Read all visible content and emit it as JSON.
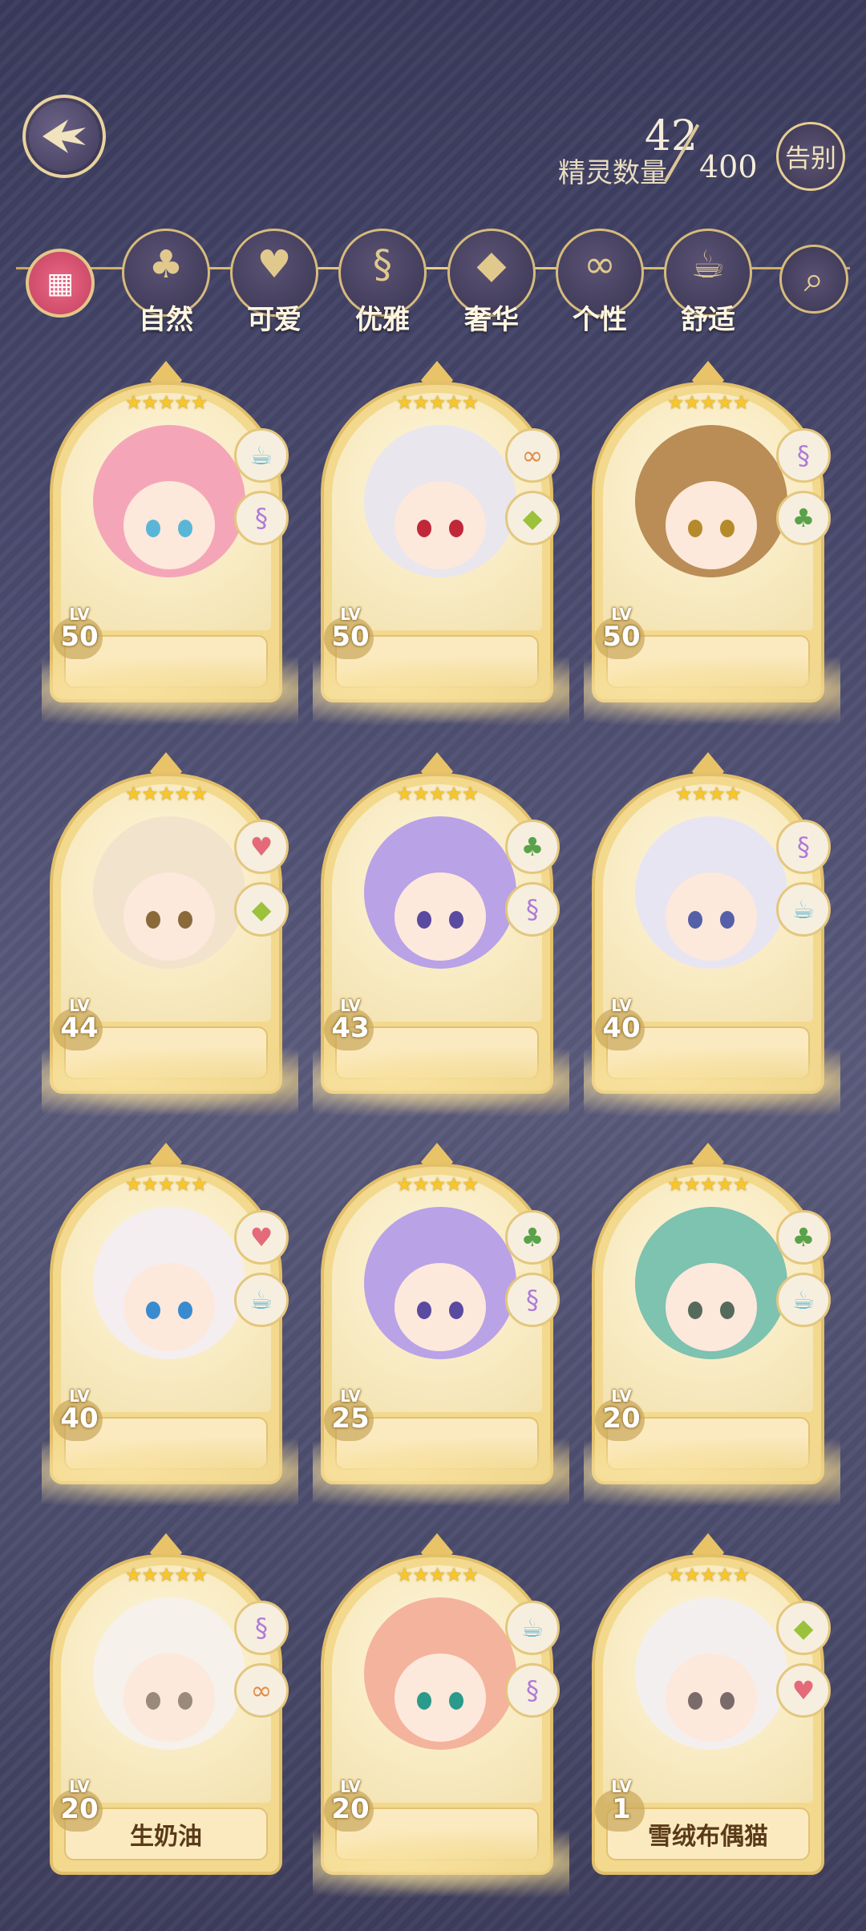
{
  "header": {
    "spirit_count": "42",
    "spirit_label": "精灵数量",
    "spirit_max": "400",
    "farewell_label": "告别"
  },
  "categories": [
    {
      "label": "自然",
      "icon": "clover-icon",
      "glyph": "♣"
    },
    {
      "label": "可爱",
      "icon": "heart-icon",
      "glyph": "♥"
    },
    {
      "label": "优雅",
      "icon": "swan-icon",
      "glyph": "§"
    },
    {
      "label": "奢华",
      "icon": "diamond-icon",
      "glyph": "◆"
    },
    {
      "label": "个性",
      "icon": "glasses-icon",
      "glyph": "∞"
    },
    {
      "label": "舒适",
      "icon": "teacup-icon",
      "glyph": "☕"
    }
  ],
  "cards": [
    {
      "level": "50",
      "lv": "LV",
      "stars": "★★★★★",
      "name": "",
      "badges": [
        "teacup-icon",
        "swan-icon"
      ]
    },
    {
      "level": "50",
      "lv": "LV",
      "stars": "★★★★★",
      "name": "",
      "badges": [
        "glasses-icon",
        "diamond-icon"
      ]
    },
    {
      "level": "50",
      "lv": "LV",
      "stars": "★★★★★",
      "name": "",
      "badges": [
        "swan-icon",
        "clover-icon"
      ]
    },
    {
      "level": "44",
      "lv": "LV",
      "stars": "★★★★★",
      "name": "",
      "badges": [
        "heart-icon",
        "diamond-icon"
      ]
    },
    {
      "level": "43",
      "lv": "LV",
      "stars": "★★★★★",
      "name": "",
      "badges": [
        "clover-icon",
        "swan-icon"
      ]
    },
    {
      "level": "40",
      "lv": "LV",
      "stars": "★★★★",
      "name": "",
      "badges": [
        "swan-icon",
        "teacup-icon"
      ]
    },
    {
      "level": "40",
      "lv": "LV",
      "stars": "★★★★★",
      "name": "",
      "badges": [
        "heart-icon",
        "teacup-icon"
      ]
    },
    {
      "level": "25",
      "lv": "LV",
      "stars": "★★★★★",
      "name": "",
      "badges": [
        "clover-icon",
        "swan-icon"
      ]
    },
    {
      "level": "20",
      "lv": "LV",
      "stars": "★★★★★",
      "name": "",
      "badges": [
        "clover-icon",
        "teacup-icon"
      ]
    },
    {
      "level": "20",
      "lv": "LV",
      "stars": "★★★★★",
      "name": "生奶油",
      "badges": [
        "swan-icon",
        "glasses-icon"
      ]
    },
    {
      "level": "20",
      "lv": "LV",
      "stars": "★★★★★",
      "name": "",
      "badges": [
        "teacup-icon",
        "swan-icon"
      ]
    },
    {
      "level": "1",
      "lv": "LV",
      "stars": "★★★★★",
      "name": "雪绒布偶猫",
      "badges": [
        "diamond-icon",
        "heart-icon"
      ]
    }
  ]
}
